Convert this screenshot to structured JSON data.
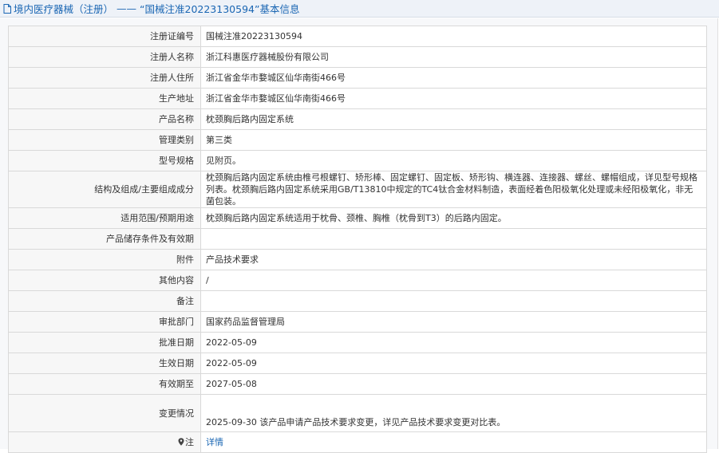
{
  "header": {
    "category": "境内医疗器械（注册）",
    "separator": "——",
    "title": "“国械注准20223130594”基本信息"
  },
  "rows": [
    {
      "label": "注册证编号",
      "value": "国械注准20223130594"
    },
    {
      "label": "注册人名称",
      "value": "浙江科惠医疗器械股份有限公司"
    },
    {
      "label": "注册人住所",
      "value": "浙江省金华市婺城区仙华南街466号"
    },
    {
      "label": "生产地址",
      "value": "浙江省金华市婺城区仙华南街466号"
    },
    {
      "label": "产品名称",
      "value": "枕颈胸后路内固定系统"
    },
    {
      "label": "管理类别",
      "value": "第三类"
    },
    {
      "label": "型号规格",
      "value": "见附页。"
    },
    {
      "label": "结构及组成/主要组成成分",
      "value": "枕颈胸后路内固定系统由椎弓根螺钉、矫形棒、固定螺钉、固定板、矫形钩、横连器、连接器、螺丝、螺帽组成，详见型号规格列表。枕颈胸后路内固定系统采用GB/T13810中规定的TC4钛合金材料制造，表面经着色阳极氧化处理或未经阳极氧化，非无菌包装。"
    },
    {
      "label": "适用范围/预期用途",
      "value": "枕颈胸后路内固定系统适用于枕骨、颈椎、胸椎（枕骨到T3）的后路内固定。"
    },
    {
      "label": "产品储存条件及有效期",
      "value": ""
    },
    {
      "label": "附件",
      "value": "产品技术要求"
    },
    {
      "label": "其他内容",
      "value": "/"
    },
    {
      "label": "备注",
      "value": ""
    },
    {
      "label": "审批部门",
      "value": "国家药品监督管理局"
    },
    {
      "label": "批准日期",
      "value": "2022-05-09"
    },
    {
      "label": "生效日期",
      "value": "2022-05-09"
    },
    {
      "label": "有效期至",
      "value": "2027-05-08"
    },
    {
      "label": "变更情况",
      "value": "2025-09-30 该产品申请产品技术要求变更，详见产品技术要求变更对比表。"
    }
  ],
  "note": {
    "label": "注",
    "link": "详情"
  },
  "icons": {
    "header": "document-icon",
    "note": "map-pin-icon"
  },
  "colors": {
    "link": "#1a66b3",
    "label_bg": "#f7f7f7",
    "border": "#d9d9d9"
  }
}
